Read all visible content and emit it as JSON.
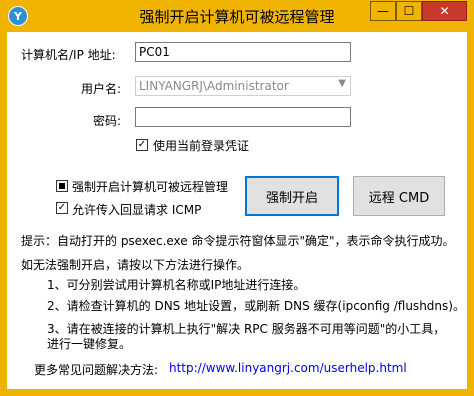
{
  "window": {
    "title": "强制开启计算机可被远程管理",
    "app_icon_glyph": "Y",
    "min_glyph": "—",
    "max_glyph": "☐",
    "close_glyph": "✕"
  },
  "form": {
    "computer_label": "计算机名/IP 地址:",
    "computer_value": "PC01",
    "user_label": "用户名:",
    "user_value": "LINYANGRJ\\Administrator",
    "password_label": "密码:",
    "password_value": "",
    "use_current_cred_label": "使用当前登录凭证",
    "use_current_cred_checked": true
  },
  "options": {
    "force_remote_label": "强制开启计算机可被远程管理",
    "allow_icmp_label": "允许传入回显请求 ICMP",
    "allow_icmp_checked": true
  },
  "buttons": {
    "force_enable": "强制开启",
    "remote_cmd": "远程 CMD"
  },
  "info": {
    "tip": "提示：自动打开的 psexec.exe 命令提示符窗体显示\"确定\"，表示命令执行成功。",
    "fail_intro": "如无法强制开启，请按以下方法进行操作。",
    "step1": "1、可分别尝试用计算机名称或IP地址进行连接。",
    "step2": "2、请检查计算机的 DNS 地址设置，或刷新 DNS 缓存(ipconfig /flushdns)。",
    "step3_line1": "3、请在被连接的计算机上执行\"解决 RPC 服务器不可用等问题\"的小工具，",
    "step3_line2": "进行一键修复。",
    "faq_label": "更多常见问题解决方法:",
    "faq_link": "http://www.linyangrj.com/userhelp.html"
  },
  "colors": {
    "titlebar": "#f0b400",
    "close_button": "#c7382d",
    "link": "#0000ee",
    "primary_border": "#0078d7"
  }
}
